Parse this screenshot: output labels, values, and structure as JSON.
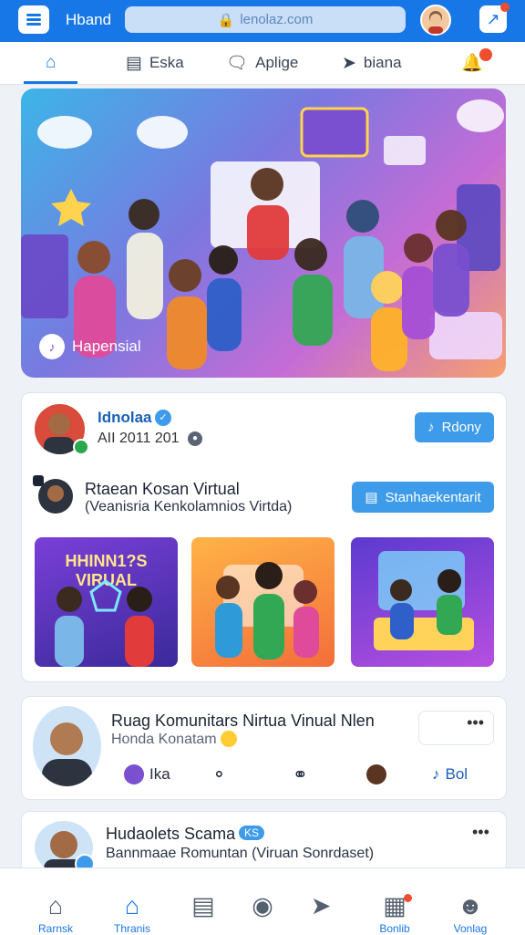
{
  "header": {
    "brand": "Hband",
    "url": "lenolaz.com",
    "menu_icon": "hamburger-icon",
    "notification_icon": "external-link-icon"
  },
  "tabs": [
    {
      "label": "",
      "icon": "home-icon"
    },
    {
      "label": "Eska",
      "icon": "grid-icon"
    },
    {
      "label": "Aplige",
      "icon": "chat-icon"
    },
    {
      "label": "biana",
      "icon": "send-icon"
    },
    {
      "label": "",
      "icon": "bell-icon"
    }
  ],
  "hero": {
    "label": "Hapensial",
    "icon": "music-icon"
  },
  "post1": {
    "author": "Idnolaa",
    "time": "AII 2011 201",
    "follow_label": "Rdony",
    "event_title": "Rtaean Kosan Virtual",
    "event_sub": "(Veanisria Kenkolamnios Virtda)",
    "event_button": "Stanhaekentarit",
    "thumb1_caption": "HHINN1?S VIRUAL"
  },
  "post2": {
    "title": "Ruag Komunitars Nirtua Vinual Nlen",
    "sub": "Honda Konatam",
    "action1": "Ika",
    "action4": "Bol"
  },
  "post3": {
    "author": "Hudaolets Scama",
    "badge": "KS",
    "sub": "Bannmaae Romuntan (Viruan Sonrdaset)"
  },
  "bottom_nav": [
    {
      "label": "Rarnsk",
      "icon": "home-icon"
    },
    {
      "label": "Thranis",
      "icon": "community-icon"
    },
    {
      "label": "",
      "icon": "inbox-icon"
    },
    {
      "label": "",
      "icon": "globe-icon"
    },
    {
      "label": "",
      "icon": "send-icon"
    },
    {
      "label": "Bonlib",
      "icon": "calendar-icon"
    },
    {
      "label": "Vonlag",
      "icon": "profile-icon"
    }
  ],
  "colors": {
    "primary": "#1877e6",
    "accent": "#3d9be9",
    "badge": "#f04d2e"
  }
}
